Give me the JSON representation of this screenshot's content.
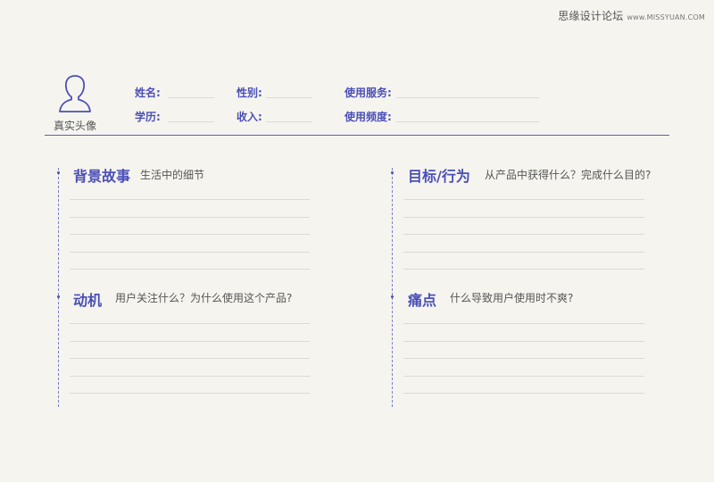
{
  "watermark": {
    "cn": "思缘设计论坛",
    "en": "www.MISSYUAN.COM"
  },
  "profile": {
    "avatar_label": "真实头像",
    "fields": {
      "name": "姓名:",
      "gender": "性别:",
      "service": "使用服务:",
      "education": "学历:",
      "income": "收入:",
      "frequency": "使用频度:"
    }
  },
  "sections": {
    "background": {
      "title": "背景故事",
      "desc": "生活中的细节"
    },
    "goals": {
      "title": "目标/行为",
      "desc": "从产品中获得什么？完成什么目的?"
    },
    "motivation": {
      "title": "动机",
      "desc": "用户关注什么？为什么使用这个产品?"
    },
    "pain_points": {
      "title": "痛点",
      "desc": "什么导致用户使用时不爽?"
    }
  },
  "colors": {
    "accent": "#4a4fb8",
    "background": "#f6f4ee",
    "rule": "#5b60c8"
  }
}
